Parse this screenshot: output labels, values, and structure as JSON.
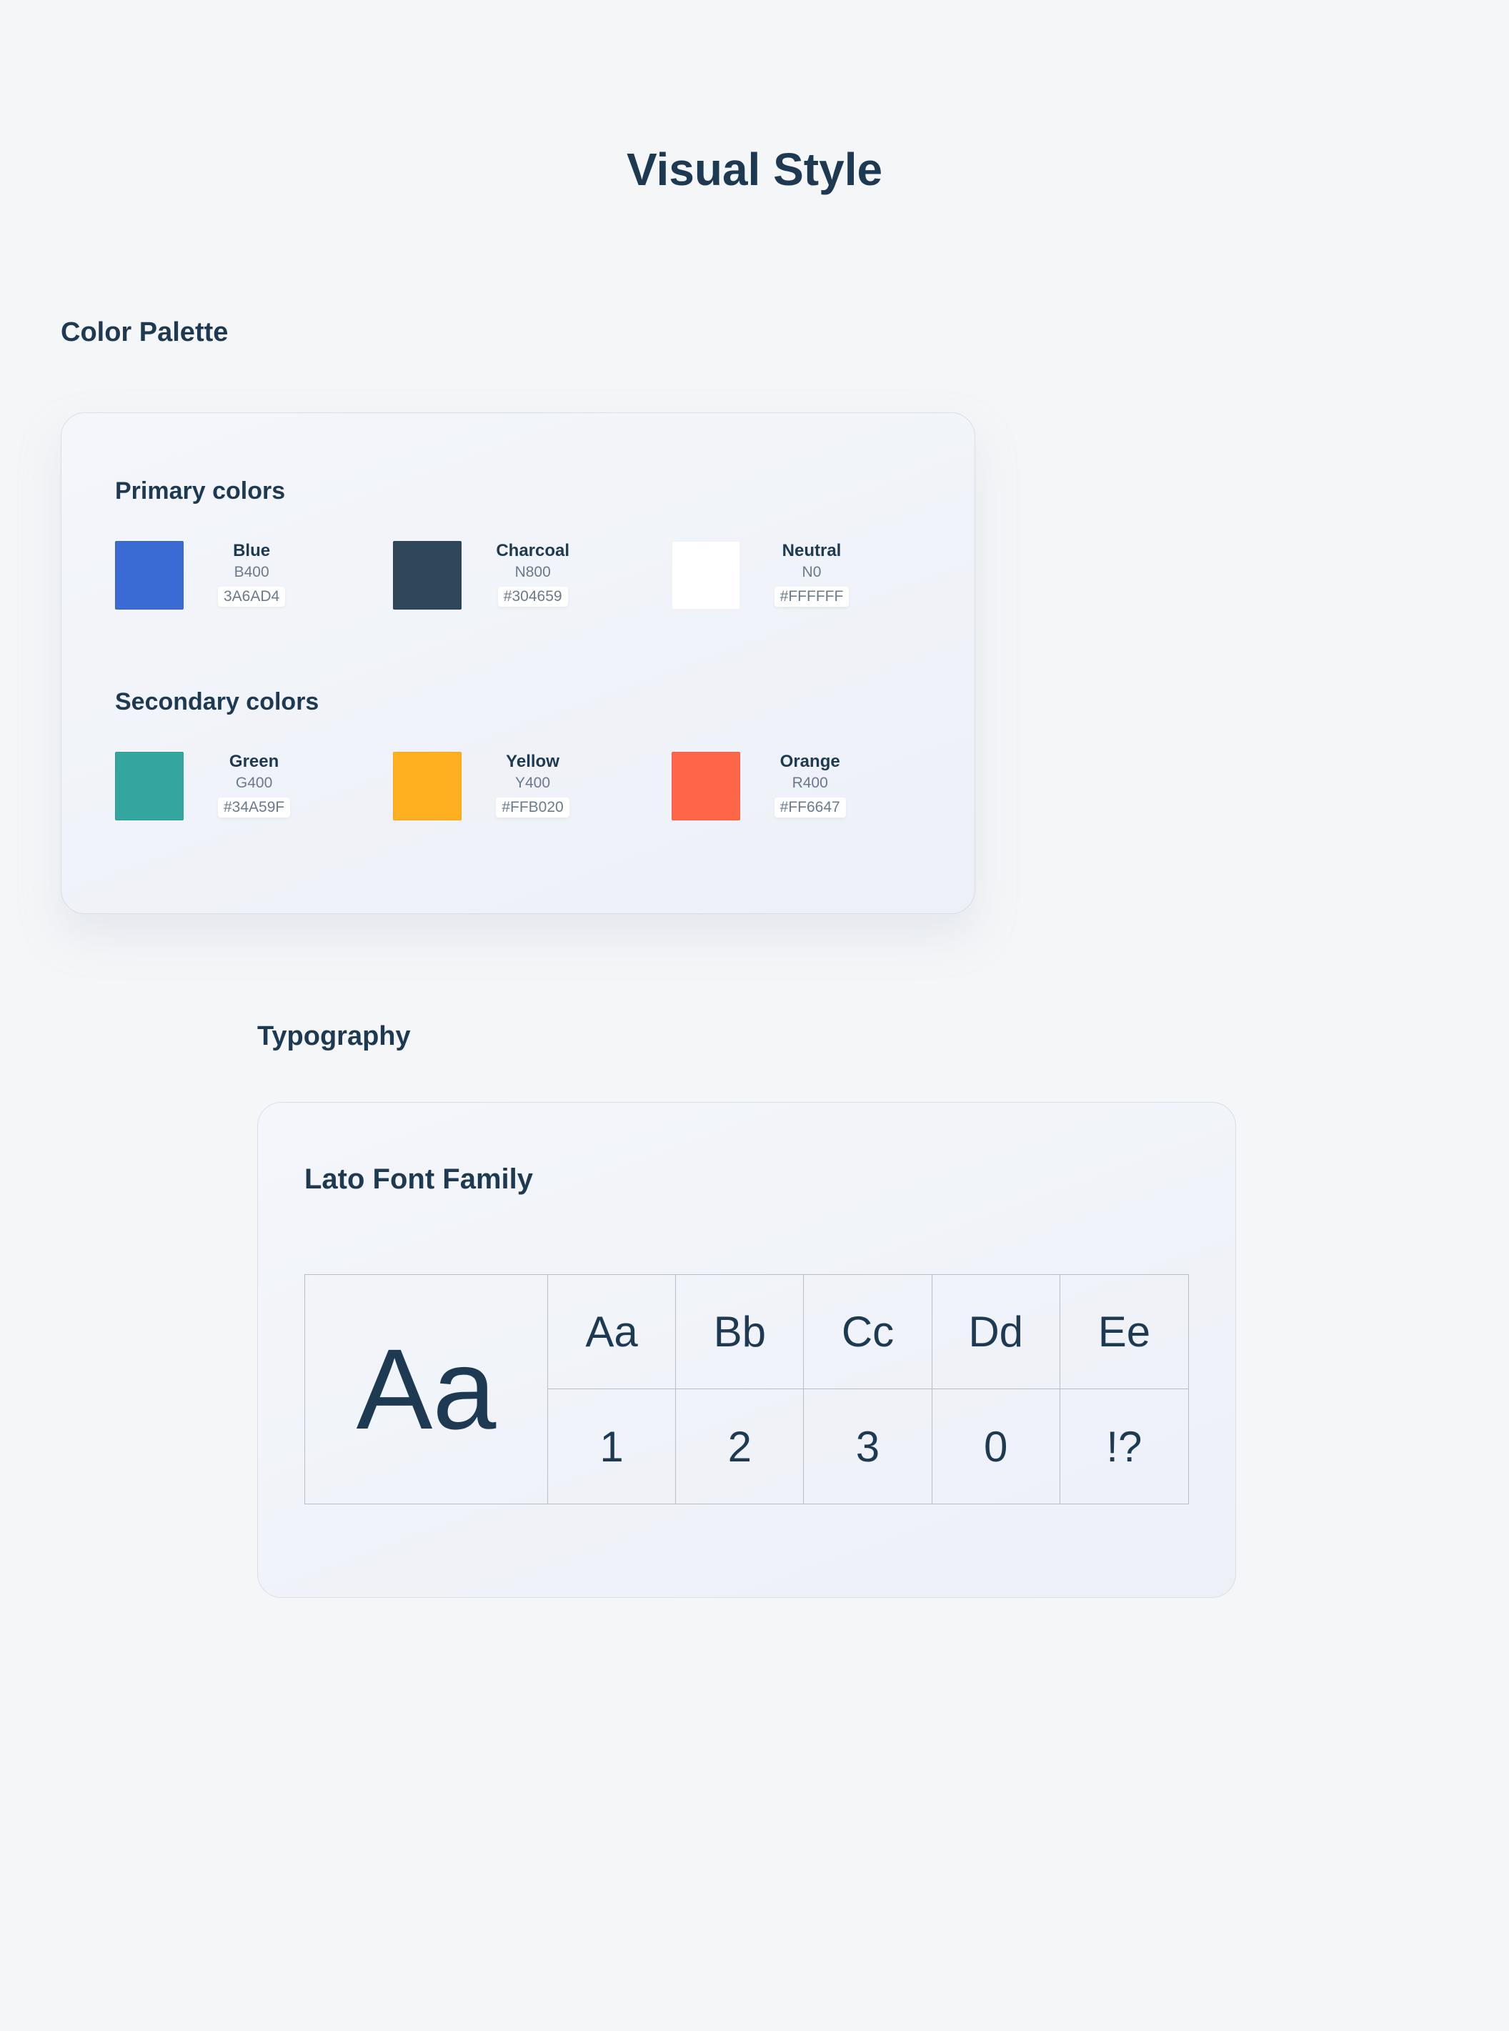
{
  "page": {
    "title": "Visual Style"
  },
  "palette": {
    "heading": "Color Palette",
    "primary_heading": "Primary colors",
    "secondary_heading": "Secondary colors",
    "primary": [
      {
        "name": "Blue",
        "token": "B400",
        "hex": "3A6AD4",
        "swatch": "#3A6AD4"
      },
      {
        "name": "Charcoal",
        "token": "N800",
        "hex": "#304659",
        "swatch": "#304659"
      },
      {
        "name": "Neutral",
        "token": "N0",
        "hex": "#FFFFFF",
        "swatch": "#FFFFFF"
      }
    ],
    "secondary": [
      {
        "name": "Green",
        "token": "G400",
        "hex": "#34A59F",
        "swatch": "#34A59F"
      },
      {
        "name": "Yellow",
        "token": "Y400",
        "hex": "#FFB020",
        "swatch": "#FFB020"
      },
      {
        "name": "Orange",
        "token": "R400",
        "hex": "#FF6647",
        "swatch": "#FF6647"
      }
    ]
  },
  "typography": {
    "heading": "Typography",
    "font_family_heading": "Lato Font Family",
    "large_sample": "Aa",
    "cells": [
      "Aa",
      "Bb",
      "Cc",
      "Dd",
      "Ee",
      "1",
      "2",
      "3",
      "0",
      "!?"
    ]
  }
}
